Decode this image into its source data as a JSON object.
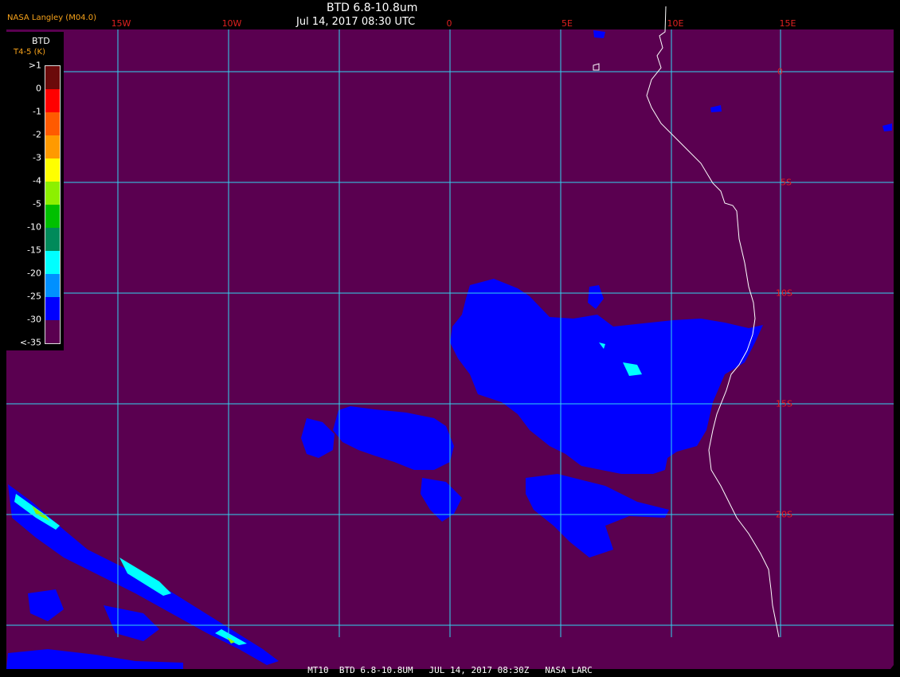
{
  "header": {
    "title": "BTD 6.8-10.8um",
    "datetime": "Jul 14, 2017 08:30 UTC",
    "credit": "NASA Langley (M04.0)"
  },
  "legend": {
    "title": "BTD",
    "subtitle": "T4-5 (K)",
    "labels": [
      ">1",
      "0",
      "-1",
      "-2",
      "-3",
      "-4",
      "-5",
      "-10",
      "-15",
      "-20",
      "-25",
      "-30",
      "<-35"
    ],
    "colors": [
      "#6b0a0a",
      "#ff0000",
      "#ff5a00",
      "#ff9a00",
      "#ffff00",
      "#8cf000",
      "#00c000",
      "#008a5a",
      "#00ffff",
      "#0090ff",
      "#0000ff",
      "#5a0050"
    ]
  },
  "map": {
    "background_color": "#5a0050",
    "grid_color": "#33d6f0",
    "coast_color": "#ffffff",
    "cloud_color": "#0000ff",
    "longitude_labels": [
      "15W",
      "10W",
      "0",
      "5E",
      "10E",
      "15E"
    ],
    "latitude_labels": [
      "0",
      "5S",
      "10S",
      "15S",
      "20S"
    ]
  },
  "footer": {
    "text": "MT10  BTD 6.8-10.8UM   JUL 14, 2017 08:30Z   NASA LARC"
  }
}
